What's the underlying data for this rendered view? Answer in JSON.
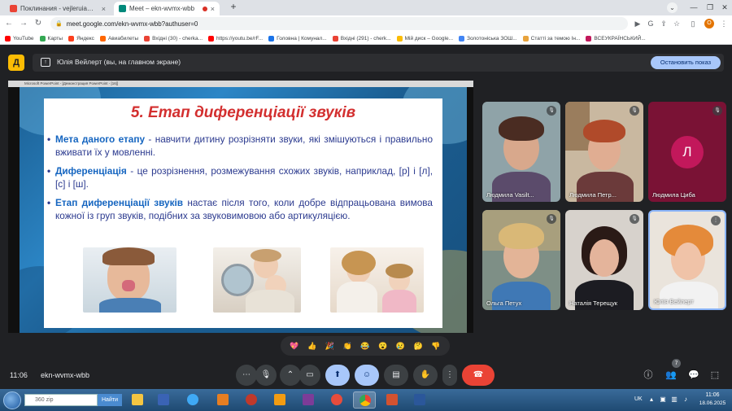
{
  "browser": {
    "tabs": [
      {
        "title": "Поклинания - vejleruia@gmail...",
        "close": "×"
      },
      {
        "title": "Meet – ekn-wvmx-wbb",
        "close": "×"
      }
    ],
    "new_tab": "+",
    "url": "meet.google.com/ekn-wvmx-wbb?authuser=0",
    "profile_initial": "О",
    "bookmarks": [
      {
        "label": "YouTube",
        "color": "#ff0000"
      },
      {
        "label": "Карты",
        "color": "#34a853"
      },
      {
        "label": "Яндекс",
        "color": "#fc3f1d"
      },
      {
        "label": "Авиабилеты",
        "color": "#ff6600"
      },
      {
        "label": "Вхідні (30) - cherka...",
        "color": "#ea4335"
      },
      {
        "label": "https://youtu.be/rF...",
        "color": "#ff0000"
      },
      {
        "label": "Головна | Комунал...",
        "color": "#1a73e8"
      },
      {
        "label": "Вхідні (291) - cherk...",
        "color": "#ea4335"
      },
      {
        "label": "Мій диск – Google...",
        "color": "#fbbc04"
      },
      {
        "label": "Золотоніська ЗОШ...",
        "color": "#4285f4"
      },
      {
        "label": "Статті за темою Ін...",
        "color": "#e8a33d"
      },
      {
        "label": "ВСЕУКРАЇНСЬКИЙ...",
        "color": "#c2185b"
      }
    ]
  },
  "meet": {
    "logo": "Д",
    "presenting_text": "Юлія Вейлерт (вы, на главном экране)",
    "stop_presenting": "Остановить показ",
    "time": "11:06",
    "meeting_code": "ekn-wvmx-wbb",
    "participant_count_badge": "7",
    "slide": {
      "app_title": "Microsoft PowerPoint - [Демонстрация PowerPoint - [16]]",
      "title": "5. Етап диференціації звуків",
      "bullets": [
        {
          "bold": "Мета даного етапу",
          "text": " - навчити дитину розрізняти звуки, які змішуються і правильно вживати їх у мовленні."
        },
        {
          "bold": "Диференціація",
          "text": " - це розрізнення, розмежування схожих звуків, наприклад, [р] і [л], [с] і [ш]."
        },
        {
          "bold": "Етап диференціації звуків",
          "text": " настає після того, коли добре відпрацьована вимова кожної із груп звуків, подібних за звуковимовою або артикуляцією."
        }
      ]
    },
    "participants": [
      {
        "name": "Людмила Vasilt..."
      },
      {
        "name": "Людмила Петр..."
      },
      {
        "name": "Людмила Циба",
        "initial": "Л"
      },
      {
        "name": "Ольга Петух"
      },
      {
        "name": "Наталія Терещук"
      },
      {
        "name": "Юлія Вейлерт"
      }
    ],
    "reactions": [
      "💖",
      "👍",
      "🎉",
      "👏",
      "😂",
      "😮",
      "😢",
      "🤔",
      "👎"
    ]
  },
  "taskbar": {
    "search_placeholder": "360 zip",
    "search_button": "Найти",
    "lang": "UK",
    "clock_time": "11:06",
    "clock_date": "18.06.2025"
  }
}
